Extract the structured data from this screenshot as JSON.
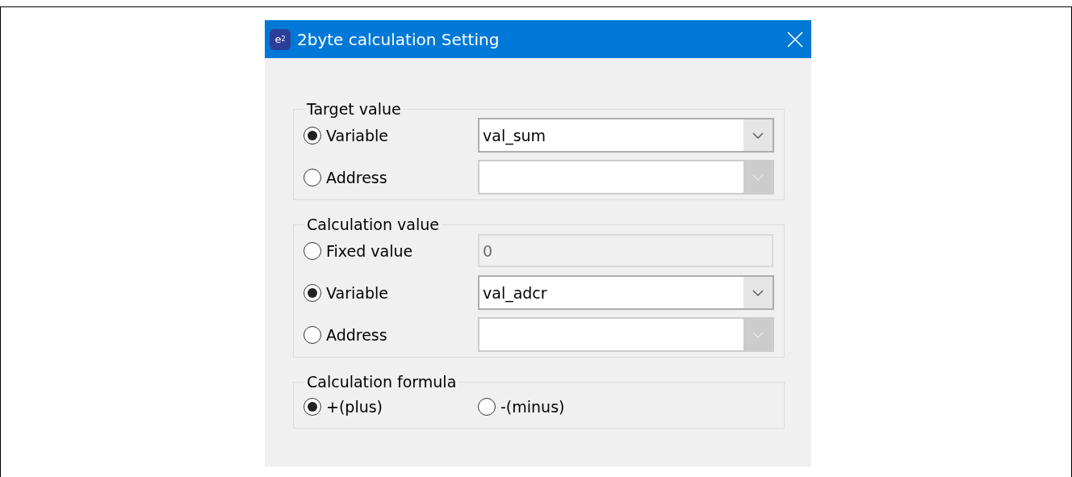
{
  "window": {
    "title": "2byte calculation Setting",
    "icon_text": "e$^{2}$"
  },
  "groups": [
    {
      "title": "Target value",
      "options": [
        {
          "label": "Variable",
          "selected": true,
          "kind": "combo",
          "value": "val_sum",
          "disabled": false
        },
        {
          "label": "Address",
          "selected": false,
          "kind": "combo",
          "disabled": true
        }
      ]
    },
    {
      "title": "Calculation value",
      "options": [
        {
          "label": "Fixed value",
          "selected": false,
          "kind": "text",
          "value": "0",
          "disabled": true
        },
        {
          "label": "Variable",
          "selected": true,
          "kind": "combo",
          "value": "val_adcr",
          "disabled": false
        },
        {
          "label": "Address",
          "selected": false,
          "kind": "combo",
          "disabled": true
        }
      ]
    }
  ],
  "formula": {
    "title": "Calculation formula",
    "options": [
      {
        "label": "+(plus)",
        "selected": true
      },
      {
        "label": "-(minus)",
        "selected": false
      }
    ]
  }
}
